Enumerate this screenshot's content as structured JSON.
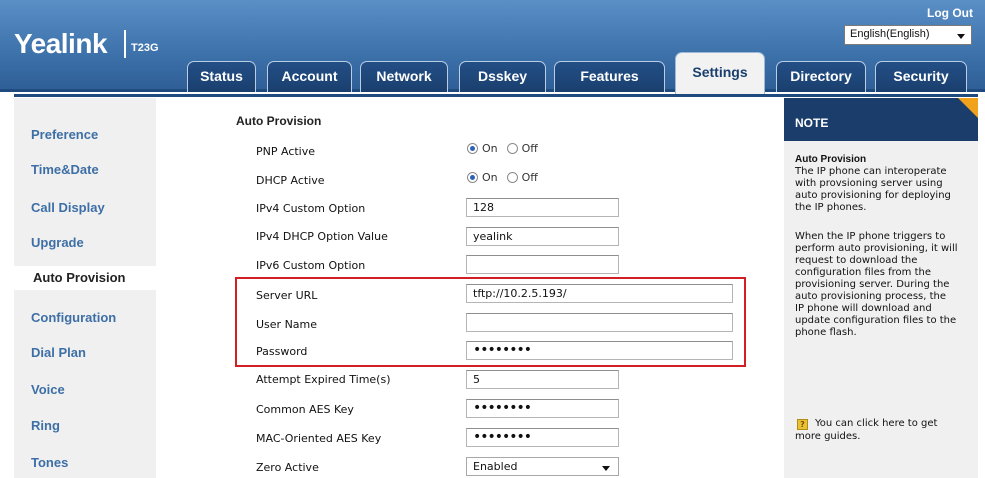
{
  "header": {
    "logo": "Yealink",
    "model": "T23G",
    "logout": "Log Out",
    "language": "English(English)"
  },
  "tabs": [
    {
      "label": "Status"
    },
    {
      "label": "Account"
    },
    {
      "label": "Network"
    },
    {
      "label": "Dsskey"
    },
    {
      "label": "Features"
    },
    {
      "label": "Settings",
      "active": true
    },
    {
      "label": "Directory"
    },
    {
      "label": "Security"
    }
  ],
  "sidebar": {
    "items": [
      {
        "label": "Preference"
      },
      {
        "label": "Time&Date"
      },
      {
        "label": "Call Display"
      },
      {
        "label": "Upgrade"
      },
      {
        "label": "Auto Provision",
        "active": true
      },
      {
        "label": "Configuration"
      },
      {
        "label": "Dial Plan"
      },
      {
        "label": "Voice"
      },
      {
        "label": "Ring"
      },
      {
        "label": "Tones"
      }
    ]
  },
  "form": {
    "section_title": "Auto Provision",
    "pnp_label": "PNP Active",
    "pnp_on": "On",
    "pnp_off": "Off",
    "dhcp_label": "DHCP Active",
    "dhcp_on": "On",
    "dhcp_off": "Off",
    "ipv4_custom_label": "IPv4 Custom Option",
    "ipv4_custom_value": "128",
    "ipv4_dhcp_label": "IPv4 DHCP Option Value",
    "ipv4_dhcp_value": "yealink",
    "ipv6_custom_label": "IPv6 Custom Option",
    "ipv6_custom_value": "",
    "server_url_label": "Server URL",
    "server_url_value": "tftp://10.2.5.193/",
    "user_name_label": "User Name",
    "user_name_value": "",
    "password_label": "Password",
    "password_value": "••••••••",
    "attempt_label": "Attempt Expired Time(s)",
    "attempt_value": "5",
    "common_aes_label": "Common AES Key",
    "common_aes_value": "••••••••",
    "mac_aes_label": "MAC-Oriented AES Key",
    "mac_aes_value": "••••••••",
    "zero_label": "Zero Active",
    "zero_value": "Enabled"
  },
  "note": {
    "header": "NOTE",
    "title": "Auto Provision",
    "lines_1": [
      "The IP phone can interoperate",
      "with provsioning server using",
      "auto provisioning for deploying",
      "the IP phones."
    ],
    "lines_2": [
      "When the IP phone triggers to",
      "perform auto provisioning, it will",
      "request to download the",
      "configuration files from the",
      "provisioning server. During the",
      "auto provisioning process, the",
      "IP phone will download and",
      "update configuration files to the",
      "phone flash."
    ],
    "help_line_1": "You can click here to get",
    "help_line_2": "more guides.",
    "help_icon_text": "?"
  }
}
